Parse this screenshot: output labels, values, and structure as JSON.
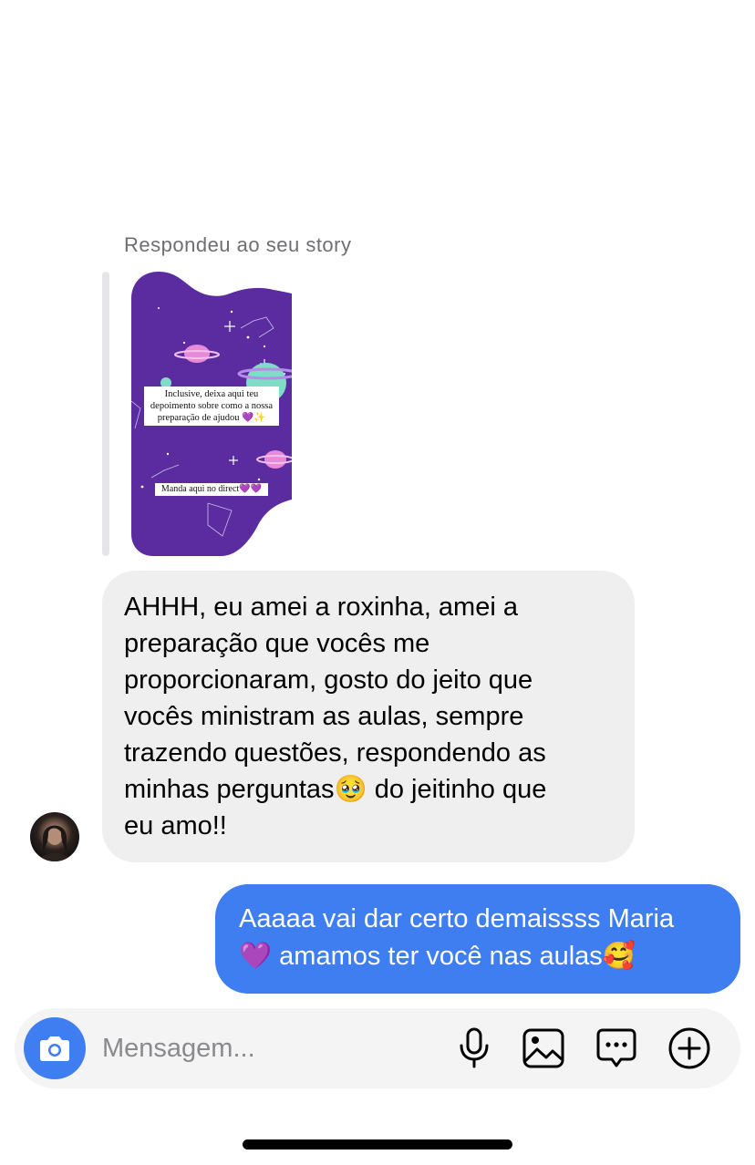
{
  "story_reply": {
    "caption": "Respondeu ao seu story",
    "story_text_main": "Inclusive, deixa aqui teu depoimento sobre como a nossa preparação de ajudou 💜✨",
    "story_text_cta": "Manda aqui no direct💜💜"
  },
  "messages": [
    {
      "direction": "incoming",
      "text": "AHHH, eu amei a roxinha, amei a\npreparação que vocês me\nproporcionaram, gosto do jeito que\nvocês ministram as aulas, sempre\ntrazendo questões, respondendo as\nminhas perguntas🥹  do jeitinho que\neu amo!!"
    },
    {
      "direction": "outgoing",
      "text": "Aaaaa vai dar certo demaissss Maria\n💜 amamos ter você nas aulas🥰"
    }
  ],
  "composer": {
    "placeholder": "Mensagem...",
    "icons": [
      "camera-icon",
      "microphone-icon",
      "image-icon",
      "sticker-chat-icon",
      "plus-circle-icon"
    ]
  },
  "colors": {
    "outgoing_bubble": "#3f7ef1",
    "incoming_bubble": "#efefef",
    "story_purple": "#5b2ca0"
  }
}
